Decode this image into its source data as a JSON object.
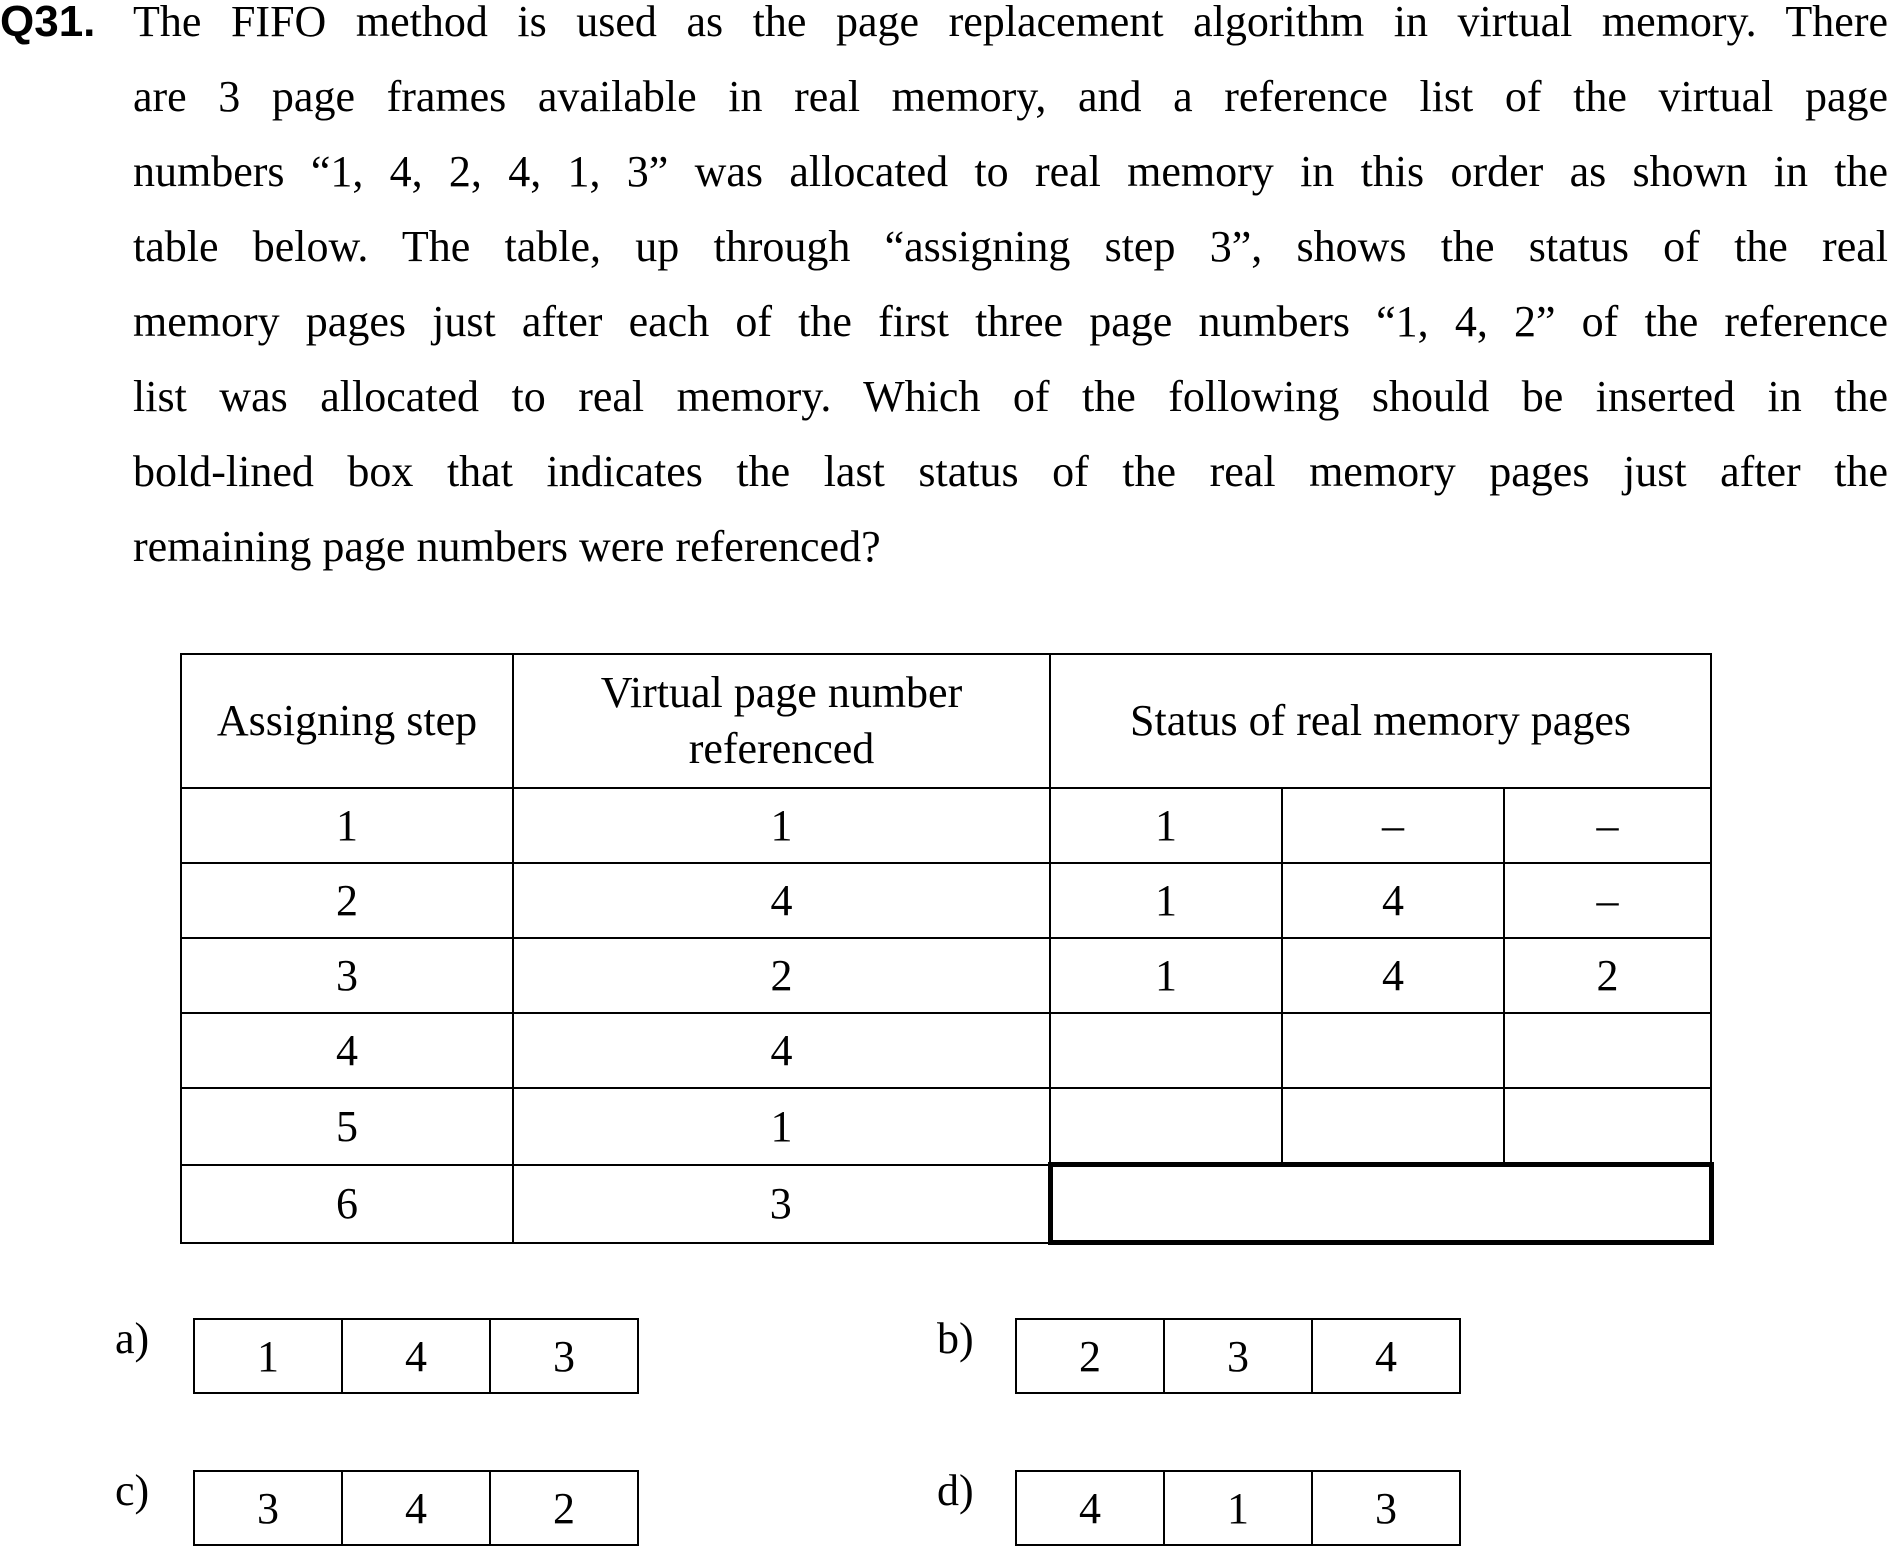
{
  "question": {
    "number": "Q31.",
    "lines": [
      "The FIFO method is used as the page replacement algorithm in virtual memory.   There",
      "are 3 page frames available in real memory, and a reference list of the virtual page",
      "numbers “1, 4, 2, 4, 1, 3” was allocated to real memory in this order as shown in the",
      "table below.   The table, up through “assigning step 3”, shows the status of the real",
      "memory pages just after each of the first three page numbers “1, 4, 2” of the reference",
      "list was allocated to real memory.   Which of the following should be inserted in the",
      "bold-lined box that indicates the last status of the real memory pages just after the",
      "remaining page numbers were referenced?"
    ]
  },
  "table": {
    "headers": {
      "step": "Assigning step",
      "virtual": "Virtual page number referenced",
      "status": "Status of real memory pages"
    },
    "rows": [
      {
        "step": "1",
        "ref": "1",
        "s1": "1",
        "s2": "–",
        "s3": "–"
      },
      {
        "step": "2",
        "ref": "4",
        "s1": "1",
        "s2": "4",
        "s3": "–"
      },
      {
        "step": "3",
        "ref": "2",
        "s1": "1",
        "s2": "4",
        "s3": "2"
      },
      {
        "step": "4",
        "ref": "4",
        "s1": "",
        "s2": "",
        "s3": ""
      },
      {
        "step": "5",
        "ref": "1",
        "s1": "",
        "s2": "",
        "s3": ""
      },
      {
        "step": "6",
        "ref": "3",
        "s1": "",
        "s2": "",
        "s3": ""
      }
    ]
  },
  "options": [
    {
      "label": "a)",
      "values": [
        "1",
        "4",
        "3"
      ]
    },
    {
      "label": "b)",
      "values": [
        "2",
        "3",
        "4"
      ]
    },
    {
      "label": "c)",
      "values": [
        "3",
        "4",
        "2"
      ]
    },
    {
      "label": "d)",
      "values": [
        "4",
        "1",
        "3"
      ]
    }
  ]
}
